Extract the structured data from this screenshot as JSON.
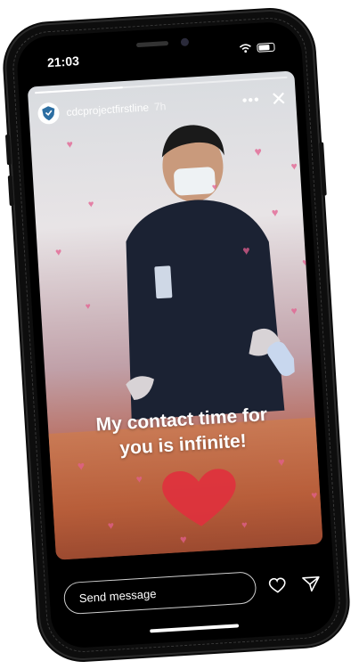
{
  "status_bar": {
    "time": "21:03"
  },
  "story": {
    "username": "cdcprojectfirstline",
    "posted_ago": "7h",
    "progress": 0.35,
    "caption_lines": [
      "My contact time for",
      "you is infinite!"
    ]
  },
  "reply": {
    "placeholder": "Send message"
  },
  "icons": {
    "avatar": "shield-logo-icon",
    "more": "more-icon",
    "close": "close-icon",
    "like": "heart-icon",
    "share": "paper-plane-icon"
  },
  "colors": {
    "heart": "#e35f8f",
    "big_heart": "#e0303d",
    "scrubs": "#1b2233"
  }
}
